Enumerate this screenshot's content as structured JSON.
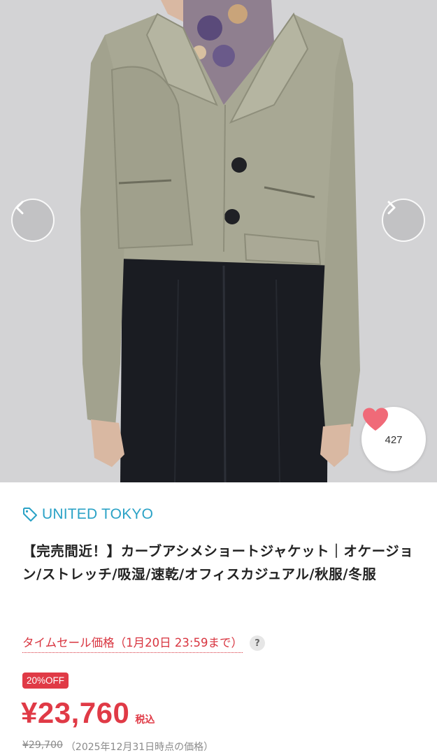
{
  "gallery": {
    "prev_icon": "chevron-left-icon",
    "next_icon": "chevron-right-icon",
    "image_subject": "jacket-product-photo"
  },
  "favorite": {
    "icon": "heart-icon",
    "count": "427",
    "color": "#f06a78"
  },
  "product": {
    "brand": "UNITED TOKYO",
    "brand_icon": "tag-icon",
    "title": "【完売間近！】カーブアシメショートジャケット｜オケージョン/ストレッチ/吸湿/速乾/オフィスカジュアル/秋服/冬服",
    "sale_label": "タイムセール価格（1月20日 23:59まで）",
    "help_label": "?",
    "discount_badge": "20%OFF",
    "price": "¥23,760",
    "tax_label": "税込",
    "old_price": "¥29,700",
    "old_price_note": "（2025年12月31日時点の価格）"
  },
  "colors": {
    "brand": "#2aa2c6",
    "sale_red": "#e03a46"
  }
}
